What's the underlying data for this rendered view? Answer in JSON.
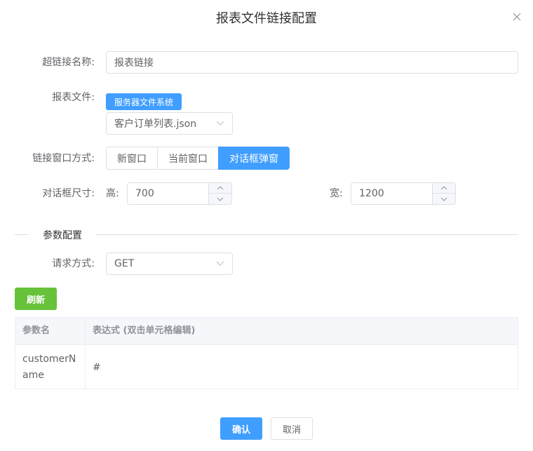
{
  "dialog": {
    "title": "报表文件链接配置",
    "close_icon": "close-icon"
  },
  "form": {
    "link_name": {
      "label": "超链接名称:",
      "value": "报表链接"
    },
    "report_file": {
      "label": "报表文件:",
      "source_tag": "服务器文件系统",
      "selected": "客户订单列表.json"
    },
    "window_mode": {
      "label": "链接窗口方式:",
      "options": [
        "新窗口",
        "当前窗口",
        "对话框弹窗"
      ],
      "active": "对话框弹窗"
    },
    "dialog_size": {
      "label": "对话框尺寸:",
      "height_label": "高:",
      "height_value": "700",
      "width_label": "宽:",
      "width_value": "1200"
    }
  },
  "params": {
    "section_title": "参数配置",
    "method": {
      "label": "请求方式:",
      "selected": "GET"
    },
    "refresh_label": "刷新",
    "table": {
      "columns": [
        "参数名",
        "表达式 (双击单元格编辑)"
      ],
      "rows": [
        {
          "name": "customerName",
          "expression": "#"
        }
      ]
    }
  },
  "footer": {
    "confirm_label": "确认",
    "cancel_label": "取消"
  },
  "colors": {
    "primary": "#409eff",
    "success": "#67c23a",
    "border": "#dcdfe6"
  }
}
